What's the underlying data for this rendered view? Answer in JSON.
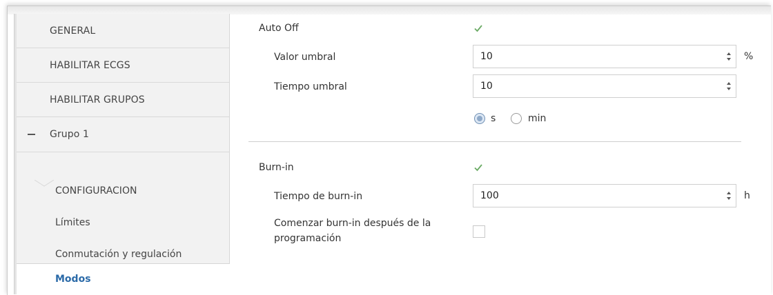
{
  "sidebar": {
    "items": [
      {
        "label": "GENERAL"
      },
      {
        "label": "HABILITAR ECGS"
      },
      {
        "label": "HABILITAR GRUPOS"
      }
    ],
    "group": {
      "label": "Grupo 1"
    },
    "subitems": [
      {
        "label": "CONFIGURACION"
      },
      {
        "label": "Límites"
      },
      {
        "label": "Conmutación y regulación"
      },
      {
        "label": "Modos",
        "active": true
      }
    ]
  },
  "main": {
    "auto_off": {
      "label": "Auto Off",
      "checked": true,
      "threshold_value": {
        "label": "Valor umbral",
        "value": "10",
        "unit": "%"
      },
      "threshold_time": {
        "label": "Tiempo umbral",
        "value": "10"
      },
      "time_units": {
        "selected": "s",
        "options": [
          "s",
          "min"
        ]
      }
    },
    "burn_in": {
      "label": "Burn-in",
      "checked": true,
      "time": {
        "label": "Tiempo de burn-in",
        "value": "100",
        "unit": "h"
      },
      "start_after_programming": {
        "label_line1": "Comenzar burn-in después de la",
        "label_line2": "programación",
        "checked": false
      }
    }
  },
  "colors": {
    "accent": "#2b6aa8",
    "check": "#6aaa64",
    "sidebar_bg": "#f2f2f2"
  }
}
